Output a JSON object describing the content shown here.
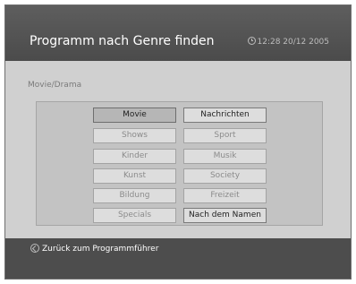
{
  "header": {
    "title": "Programm nach Genre finden",
    "clock": "12:28 20/12 2005"
  },
  "category": "Movie/Drama",
  "genres": {
    "left": [
      {
        "label": "Movie"
      },
      {
        "label": "Shows"
      },
      {
        "label": "Kinder"
      },
      {
        "label": "Kunst"
      },
      {
        "label": "Bildung"
      },
      {
        "label": "Specials"
      }
    ],
    "right": [
      {
        "label": "Nachrichten"
      },
      {
        "label": "Sport"
      },
      {
        "label": "Musik"
      },
      {
        "label": "Society"
      },
      {
        "label": "Freizeit"
      },
      {
        "label": "Nach dem Namen"
      }
    ],
    "selected": "Movie"
  },
  "footer": {
    "hint": "Zurück zum Programmführer"
  },
  "icons": {
    "clock": "clock-icon",
    "back_key": "back-key-icon"
  }
}
